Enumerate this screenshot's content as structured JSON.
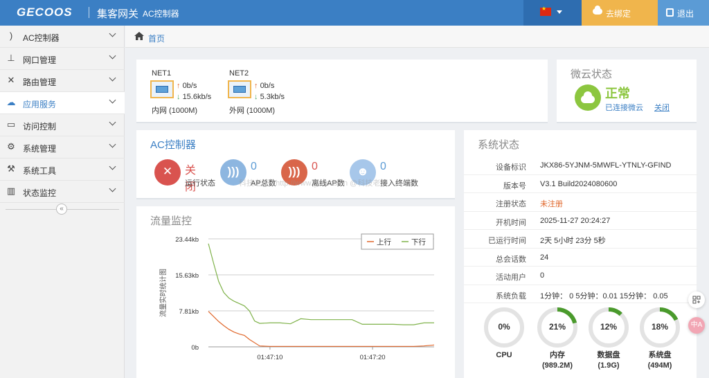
{
  "header": {
    "logo": "GECOOS",
    "brand": "集客网关",
    "subtitle": "AC控制器",
    "language_icon": "china-flag-icon",
    "unbind_label": "去绑定",
    "logout_label": "退出",
    "accent_color": "#3b7fc4"
  },
  "sidebar": {
    "items": [
      {
        "label": "AC控制器",
        "icon": "rss-icon"
      },
      {
        "label": "网口管理",
        "icon": "sitemap-icon"
      },
      {
        "label": "路由管理",
        "icon": "shuffle-icon"
      },
      {
        "label": "应用服务",
        "icon": "cloud-icon"
      },
      {
        "label": "访问控制",
        "icon": "monitor-icon"
      },
      {
        "label": "系统管理",
        "icon": "gear-icon"
      },
      {
        "label": "系统工具",
        "icon": "wrench-icon"
      },
      {
        "label": "状态监控",
        "icon": "bar-chart-icon"
      }
    ],
    "active_index": 3,
    "collapse_glyph": "«"
  },
  "breadcrumb": {
    "home": "首页"
  },
  "net": [
    {
      "name": "NET1",
      "up": "0b/s",
      "down": "15.6kb/s",
      "sub": "内网 (1000M)"
    },
    {
      "name": "NET2",
      "up": "0b/s",
      "down": "5.3kb/s",
      "sub": "外网 (1000M)"
    }
  ],
  "cloud": {
    "title": "微云状态",
    "status": "正常",
    "connected": "已连接微云",
    "close_link": "关闭",
    "status_color": "#8cc63f"
  },
  "ac": {
    "title": "AC控制器",
    "stats": [
      {
        "value": "关闭",
        "label": "运行状态"
      },
      {
        "value": "0",
        "label": "AP总数"
      },
      {
        "value": "0",
        "label": "离线AP数"
      },
      {
        "value": "0",
        "label": "接入终端数"
      }
    ],
    "watermark": "科技老王 / http://www.gecoos.cn @科技老王"
  },
  "traffic": {
    "title": "流量监控"
  },
  "chart_data": {
    "type": "line",
    "ylabel": "流量实时统计图",
    "y_ticks": [
      "23.44kb",
      "15.63kb",
      "7.81kb",
      "0b"
    ],
    "x_ticks": [
      "01:47:10",
      "01:47:20"
    ],
    "ylim": [
      0,
      23.44
    ],
    "x_range_seconds": [
      0,
      22
    ],
    "grid": true,
    "legend_position": "top-right",
    "series": [
      {
        "name": "上行",
        "color": "#e0672b",
        "x": [
          0,
          0.5,
          1,
          1.5,
          2,
          2.5,
          3,
          3.5,
          4,
          5,
          6,
          7,
          8,
          9,
          10,
          11,
          12,
          13,
          14,
          15,
          16,
          17,
          18,
          19,
          20,
          21,
          22
        ],
        "values": [
          7.7,
          6.6,
          5.5,
          4.6,
          3.8,
          3.2,
          2.8,
          2.5,
          1.6,
          0.2,
          0.1,
          0.1,
          0.1,
          0.1,
          0.1,
          0.1,
          0.1,
          0.1,
          0.1,
          0.1,
          0.1,
          0.1,
          0.1,
          0.1,
          0.1,
          0.2,
          0.4
        ]
      },
      {
        "name": "下行",
        "color": "#7fb24a",
        "x": [
          0,
          0.5,
          1,
          1.5,
          2,
          2.5,
          3,
          3.5,
          4,
          4.5,
          5,
          6,
          7,
          8,
          9,
          10,
          11,
          12,
          13,
          14,
          15,
          16,
          17,
          18,
          19,
          20,
          21,
          22
        ],
        "values": [
          22.4,
          18.2,
          14.2,
          11.8,
          10.6,
          9.9,
          9.4,
          8.9,
          7.8,
          5.6,
          5.1,
          5.2,
          5.2,
          5.0,
          6.1,
          5.9,
          5.9,
          5.9,
          5.9,
          5.9,
          4.9,
          4.9,
          4.9,
          4.9,
          4.8,
          4.8,
          5.2,
          5.2
        ]
      }
    ]
  },
  "system": {
    "title": "系统状态",
    "rows": [
      {
        "key": "设备标识",
        "value": "JKX86-5YJNM-5MWFL-YTNLY-GFIND"
      },
      {
        "key": "版本号",
        "value": "V3.1 Build2024080600"
      },
      {
        "key": "注册状态",
        "value": "未注册"
      },
      {
        "key": "开机时间",
        "value": "2025-11-27 20:24:27"
      },
      {
        "key": "已运行时间",
        "value": "2天 5小时 23分 5秒"
      },
      {
        "key": "总会话数",
        "value": "24"
      },
      {
        "key": "活动用户",
        "value": "0"
      },
      {
        "key": "系统负载",
        "value": "1分钟： 0  5分钟：0.01  15分钟： 0.05"
      }
    ],
    "gauges": [
      {
        "percent": 0,
        "label": "0%",
        "name": "CPU",
        "sub": ""
      },
      {
        "percent": 21,
        "label": "21%",
        "name": "内存",
        "sub": "(989.2M)"
      },
      {
        "percent": 12,
        "label": "12%",
        "name": "数据盘",
        "sub": "(1.9G)"
      },
      {
        "percent": 18,
        "label": "18%",
        "name": "系统盘",
        "sub": "(494M)"
      }
    ],
    "gauge_color": "#4a9a2c",
    "gauge_track": "#e3e3e3"
  },
  "float_buttons": {
    "b2": "中A"
  }
}
